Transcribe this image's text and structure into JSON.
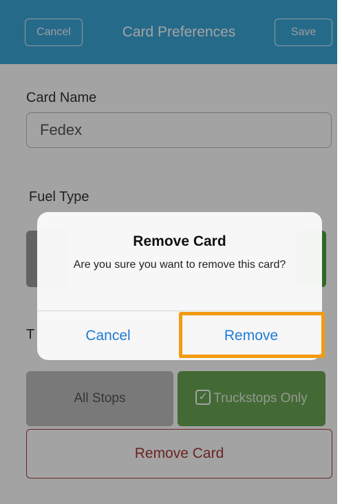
{
  "navbar": {
    "cancel_label": "Cancel",
    "title": "Card Preferences",
    "save_label": "Save"
  },
  "card_name": {
    "label": "Card Name",
    "value": "Fedex"
  },
  "fuel_type": {
    "label": "Fuel Type"
  },
  "stops": {
    "label_partial": "T",
    "all_stops_label": "All Stops",
    "truckstops_label": "Truckstops Only",
    "truckstops_checked": true
  },
  "remove_card_label": "Remove Card",
  "alert": {
    "title": "Remove Card",
    "message": "Are you sure you want to remove this card?",
    "cancel_label": "Cancel",
    "remove_label": "Remove"
  },
  "colors": {
    "navbar": "#3ca7d8",
    "alert_button_text": "#1f7ad6",
    "highlight": "#f39a10",
    "destructive": "#a83838",
    "selected_green": "#4ea33c"
  }
}
